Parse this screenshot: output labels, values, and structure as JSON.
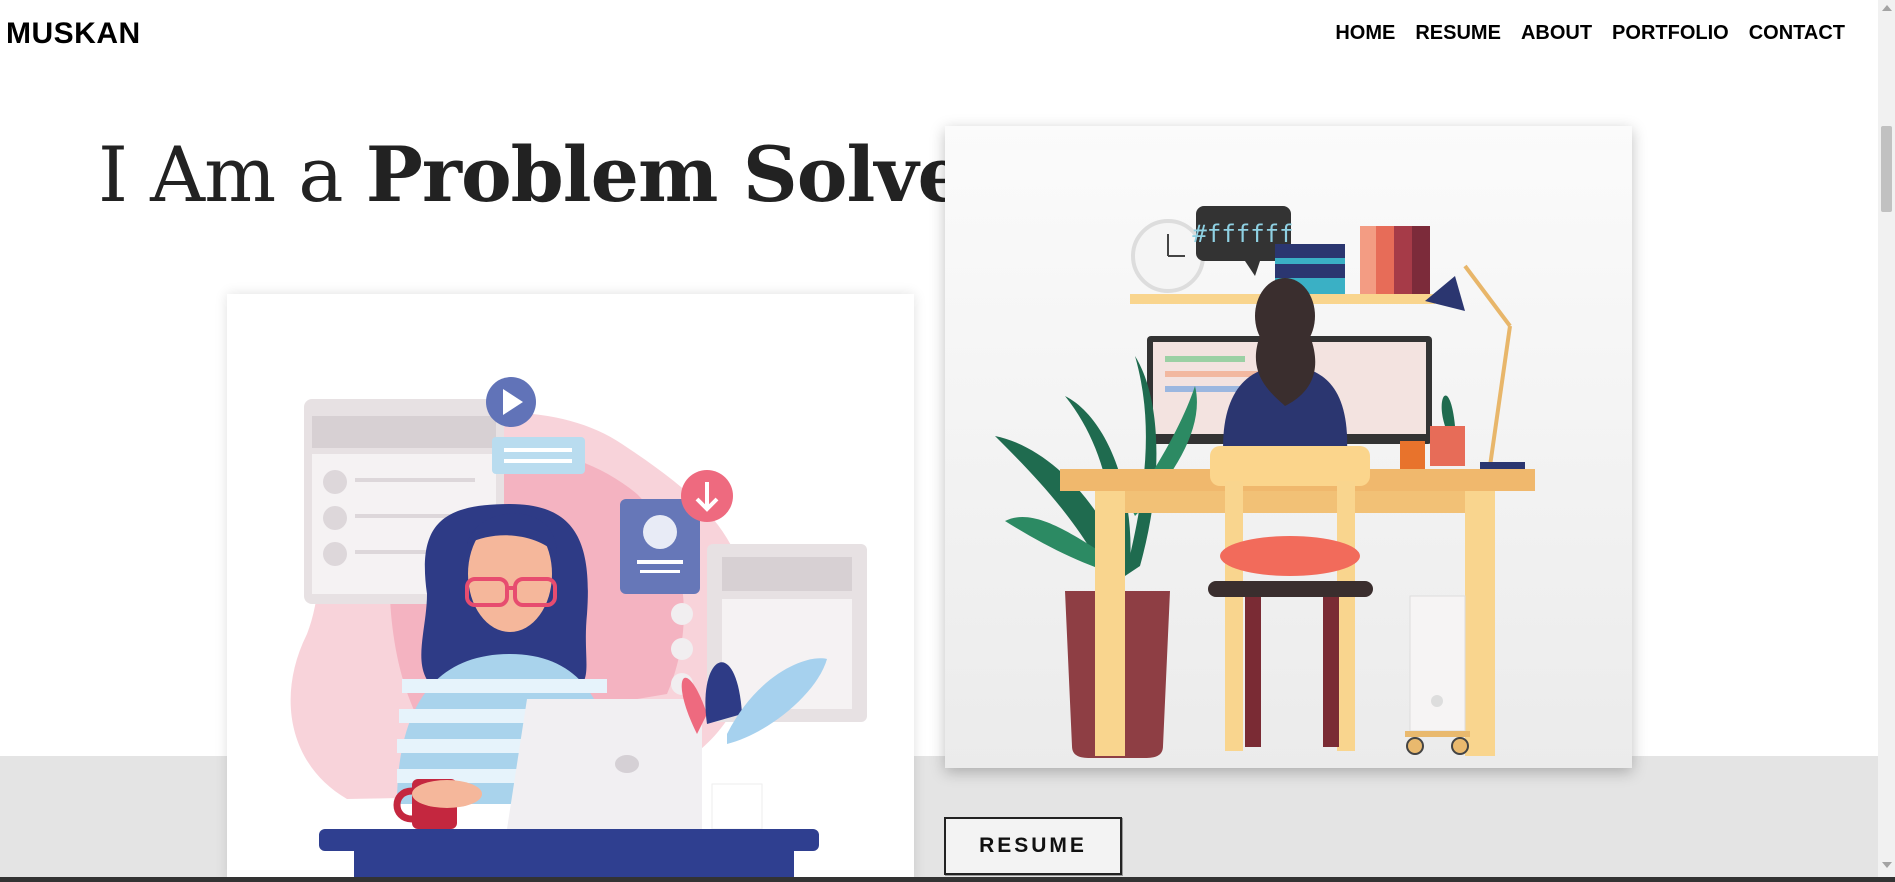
{
  "brand": "MUSKAN",
  "nav": {
    "items": [
      {
        "label": "HOME"
      },
      {
        "label": "RESUME"
      },
      {
        "label": "ABOUT"
      },
      {
        "label": "PORTFOLIO"
      },
      {
        "label": "CONTACT"
      }
    ]
  },
  "hero": {
    "title_light": "I Am a ",
    "title_bold": "Problem Solver",
    "resume_button": "RESUME"
  },
  "illustrations": {
    "right_bubble_text": "#ffffff"
  },
  "colors": {
    "band": "#e4e4e4",
    "text": "#222222"
  }
}
